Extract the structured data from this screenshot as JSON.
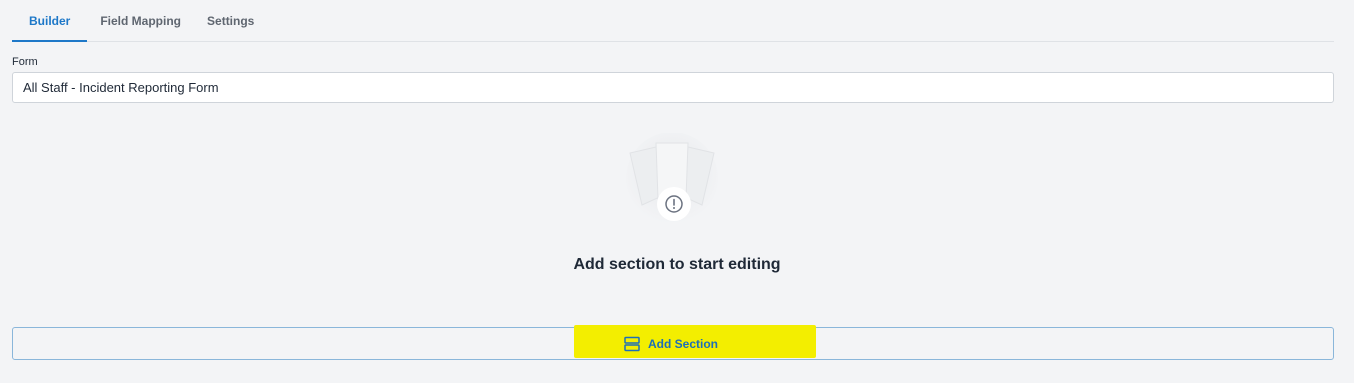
{
  "tabs": [
    {
      "label": "Builder",
      "active": true
    },
    {
      "label": "Field Mapping",
      "active": false
    },
    {
      "label": "Settings",
      "active": false
    }
  ],
  "form": {
    "label": "Form",
    "value": "All Staff - Incident Reporting Form"
  },
  "empty_state": {
    "icon": "empty-cards-alert-icon",
    "message": "Add section to start editing"
  },
  "add_section": {
    "label": "Add Section",
    "icon": "section-layout-icon",
    "highlight_color": "#f3ee00"
  },
  "colors": {
    "accent": "#1e78c8",
    "background": "#f3f4f6"
  }
}
